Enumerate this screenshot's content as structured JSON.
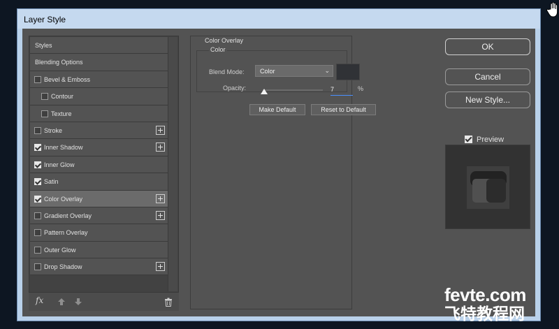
{
  "window": {
    "title": "Layer Style"
  },
  "styles_list": [
    {
      "label": "Styles",
      "checkbox": false,
      "plus": false,
      "indent": 0
    },
    {
      "label": "Blending Options",
      "checkbox": false,
      "plus": false,
      "indent": 0
    },
    {
      "label": "Bevel & Emboss",
      "checkbox": true,
      "checked": false,
      "plus": false,
      "indent": 0
    },
    {
      "label": "Contour",
      "checkbox": true,
      "checked": false,
      "plus": false,
      "indent": 1
    },
    {
      "label": "Texture",
      "checkbox": true,
      "checked": false,
      "plus": false,
      "indent": 1
    },
    {
      "label": "Stroke",
      "checkbox": true,
      "checked": false,
      "plus": true,
      "indent": 0
    },
    {
      "label": "Inner Shadow",
      "checkbox": true,
      "checked": true,
      "plus": true,
      "indent": 0
    },
    {
      "label": "Inner Glow",
      "checkbox": true,
      "checked": true,
      "plus": false,
      "indent": 0
    },
    {
      "label": "Satin",
      "checkbox": true,
      "checked": true,
      "plus": false,
      "indent": 0
    },
    {
      "label": "Color Overlay",
      "checkbox": true,
      "checked": true,
      "plus": true,
      "indent": 0,
      "selected": true
    },
    {
      "label": "Gradient Overlay",
      "checkbox": true,
      "checked": false,
      "plus": true,
      "indent": 0
    },
    {
      "label": "Pattern Overlay",
      "checkbox": true,
      "checked": false,
      "plus": false,
      "indent": 0
    },
    {
      "label": "Outer Glow",
      "checkbox": true,
      "checked": false,
      "plus": false,
      "indent": 0
    },
    {
      "label": "Drop Shadow",
      "checkbox": true,
      "checked": false,
      "plus": true,
      "indent": 0
    }
  ],
  "footer": {
    "fx": "fx"
  },
  "color_overlay": {
    "section_title": "Color Overlay",
    "group_title": "Color",
    "blend_mode_label": "Blend Mode:",
    "blend_mode_value": "Color",
    "opacity_label": "Opacity:",
    "opacity_value": "7",
    "opacity_unit": "%",
    "overlay_color": "#303236",
    "make_default": "Make Default",
    "reset_default": "Reset to Default"
  },
  "buttons": {
    "ok": "OK",
    "cancel": "Cancel",
    "new_style": "New Style..."
  },
  "preview": {
    "label": "Preview",
    "checked": true
  },
  "watermark": {
    "top": "fevte.com",
    "bottom": "飞特教程网"
  }
}
